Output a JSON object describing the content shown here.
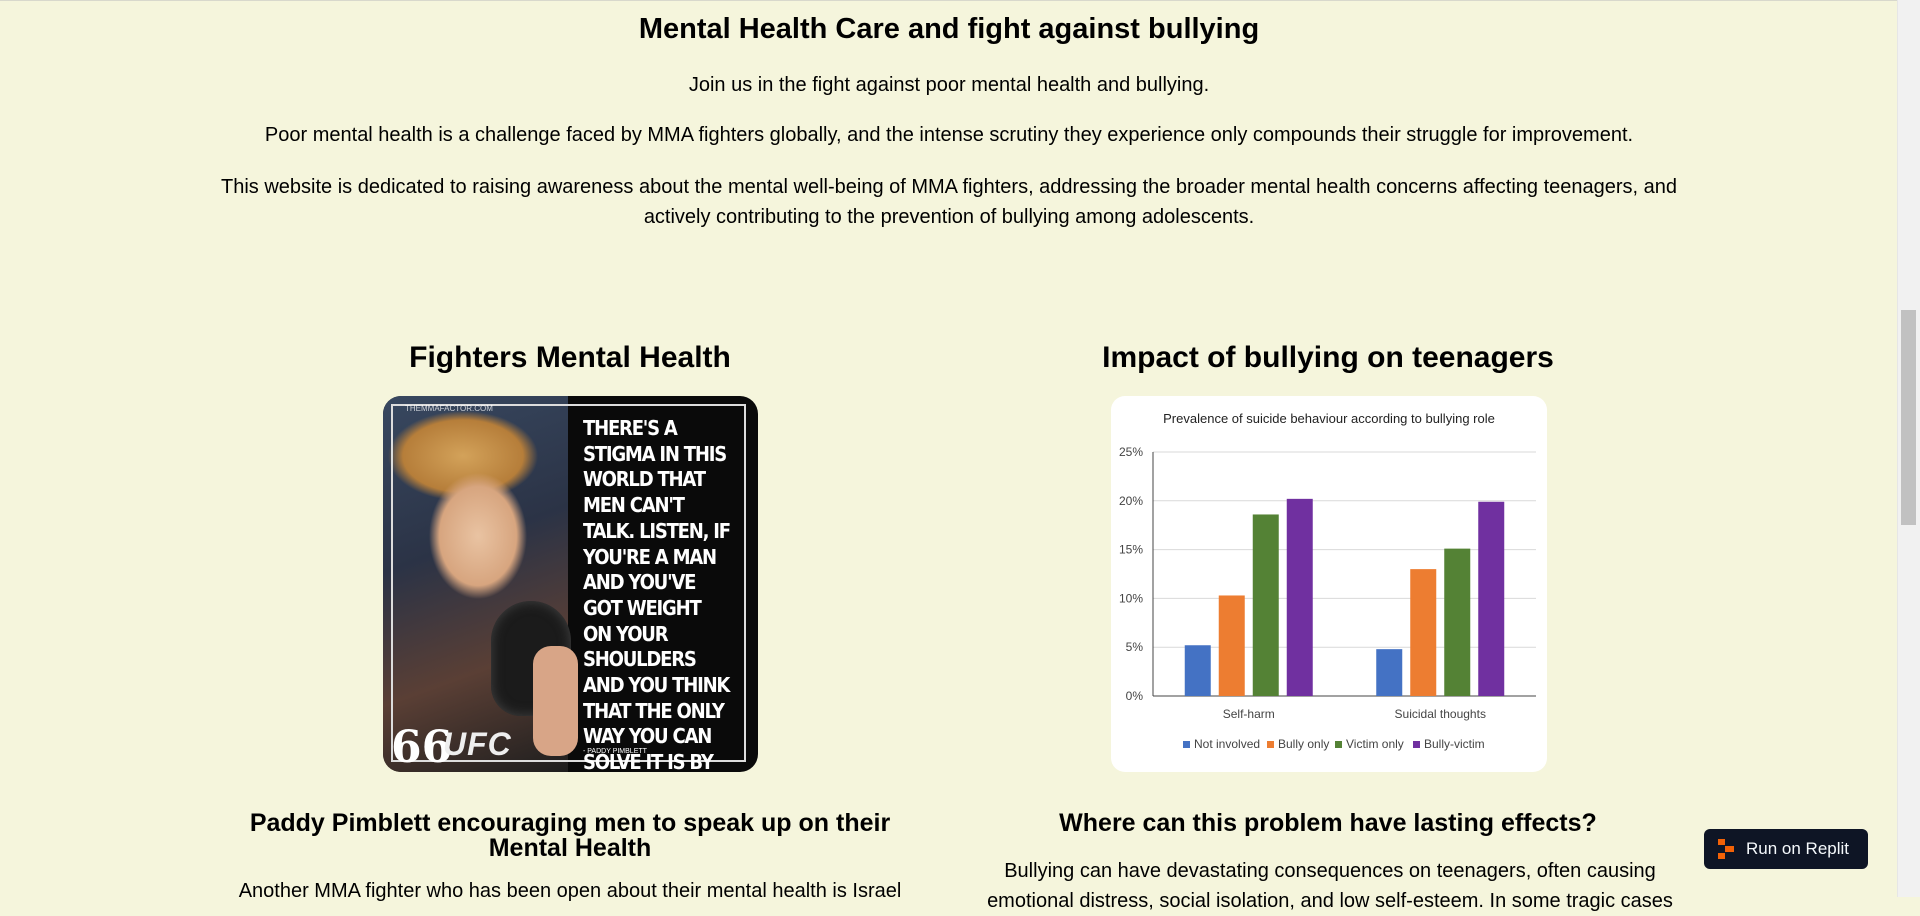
{
  "hero": {
    "title": "Mental Health Care and fight against bullying",
    "paragraphs": [
      "Join us in the fight against poor mental health and bullying.",
      "Poor mental health is a challenge faced by MMA fighters globally, and the intense scrutiny they experience only compounds their struggle for improvement.",
      "This website is dedicated to raising awareness about the mental well-being of MMA fighters, addressing the broader mental health concerns affecting teenagers, and actively contributing to the prevention of bullying among adolescents."
    ]
  },
  "left_section": {
    "heading": "Fighters Mental Health",
    "poster": {
      "quote": "THERE'S A STIGMA IN THIS WORLD THAT MEN CAN'T TALK. LISTEN, IF YOU'RE A MAN AND YOU'VE GOT WEIGHT ON YOUR SHOULDERS AND YOU THINK THAT THE ONLY WAY YOU CAN SOLVE IT IS BY KILLING YOURSELF PLEASE SPEAK TO SOMEONE.",
      "author": "- PADDY PIMBLETT",
      "site": "THEMMAFACTOR.COM",
      "quote_mark": "66",
      "ufc": "UFC"
    },
    "subheading": "Paddy Pimblett encouraging men to speak up on their Mental Health",
    "body": "Another MMA fighter who has been open about their mental health is Israel"
  },
  "right_section": {
    "heading": "Impact of bullying on teenagers",
    "subheading": "Where can this problem have lasting effects?",
    "body": "Bullying can have devastating consequences on teenagers, often causing emotional distress, social isolation, and low self-esteem. In some tragic cases"
  },
  "chart_data": {
    "type": "bar",
    "title": "Prevalence of suicide behaviour according to bullying role",
    "categories": [
      "Self-harm",
      "Suicidal thoughts"
    ],
    "series": [
      {
        "name": "Not involved",
        "values": [
          5.2,
          4.8
        ],
        "color": "#4472c4"
      },
      {
        "name": "Bully only",
        "values": [
          10.3,
          13.0
        ],
        "color": "#ed7d31"
      },
      {
        "name": "Victim only",
        "values": [
          18.6,
          15.1
        ],
        "color": "#548235"
      },
      {
        "name": "Bully-victim",
        "values": [
          20.2,
          19.9
        ],
        "color": "#7030a0"
      }
    ],
    "yticks": [
      "0%",
      "5%",
      "10%",
      "15%",
      "20%",
      "25%"
    ],
    "ylim": [
      0,
      25
    ],
    "grid": true,
    "legend": "bottom"
  },
  "replit": {
    "label": "Run on Replit",
    "icon": "replit-icon"
  }
}
